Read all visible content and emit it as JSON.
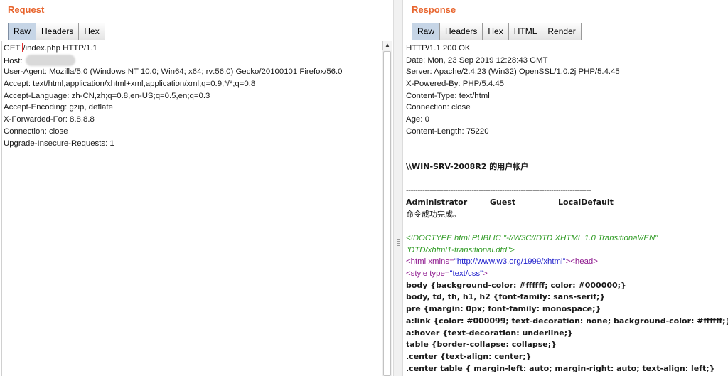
{
  "request": {
    "title": "Request",
    "tabs": [
      {
        "label": "Raw",
        "active": true
      },
      {
        "label": "Headers",
        "active": false
      },
      {
        "label": "Hex",
        "active": false
      }
    ],
    "lines": {
      "l0_pre": "GET ",
      "l0_post": "/index.php HTTP/1.1",
      "l1": "Host:",
      "l2": "User-Agent: Mozilla/5.0 (Windows NT 10.0; Win64; x64; rv:56.0) Gecko/20100101 Firefox/56.0",
      "l3": "Accept: text/html,application/xhtml+xml,application/xml;q=0.9,*/*;q=0.8",
      "l4": "Accept-Language: zh-CN,zh;q=0.8,en-US;q=0.5,en;q=0.3",
      "l5": "Accept-Encoding: gzip, deflate",
      "l6": "X-Forwarded-For: 8.8.8.8",
      "l7": "Connection: close",
      "l8": "Upgrade-Insecure-Requests: 1"
    }
  },
  "response": {
    "title": "Response",
    "tabs": [
      {
        "label": "Raw",
        "active": true
      },
      {
        "label": "Headers",
        "active": false
      },
      {
        "label": "Hex",
        "active": false
      },
      {
        "label": "HTML",
        "active": false
      },
      {
        "label": "Render",
        "active": false
      }
    ],
    "headers": {
      "status": "HTTP/1.1 200 OK",
      "date": "Date: Mon, 23 Sep 2019 12:28:43 GMT",
      "server": "Server: Apache/2.4.23 (Win32) OpenSSL/1.0.2j PHP/5.4.45",
      "powered": "X-Powered-By: PHP/5.4.45",
      "ctype": "Content-Type: text/html",
      "conn": "Connection: close",
      "age": "Age: 0",
      "clen": "Content-Length: 75220"
    },
    "body": {
      "accounts_title": "\\\\WIN-SRV-2008R2 的用户帐户",
      "separator": "-------------------------------------------------------------------------------",
      "user1": "Administrator",
      "user2": "Guest",
      "user3": "LocalDefault",
      "success": "命令成功完成。",
      "doctype1": "<!DOCTYPE html PUBLIC \"-//W3C//DTD XHTML 1.0 Transitional//EN\"",
      "doctype2": "\"DTD/xhtml1-transitional.dtd\">",
      "html_open": "<html",
      "html_attr": " xmlns=",
      "html_val": "\"http://www.w3.org/1999/xhtml\"",
      "html_close": ">",
      "head_tag": "<head>",
      "style_open": "<style",
      "style_attr": " type=",
      "style_val": "\"text/css\"",
      "style_close": ">",
      "css": [
        "body {background-color: #ffffff; color: #000000;}",
        "body, td, th, h1, h2 {font-family: sans-serif;}",
        "pre {margin: 0px; font-family: monospace;}",
        "a:link {color: #000099; text-decoration: none; background-color: #ffffff;}",
        "a:hover {text-decoration: underline;}",
        "table {border-collapse: collapse;}",
        ".center {text-align: center;}",
        ".center table { margin-left: auto; margin-right: auto; text-align: left;}"
      ]
    }
  }
}
